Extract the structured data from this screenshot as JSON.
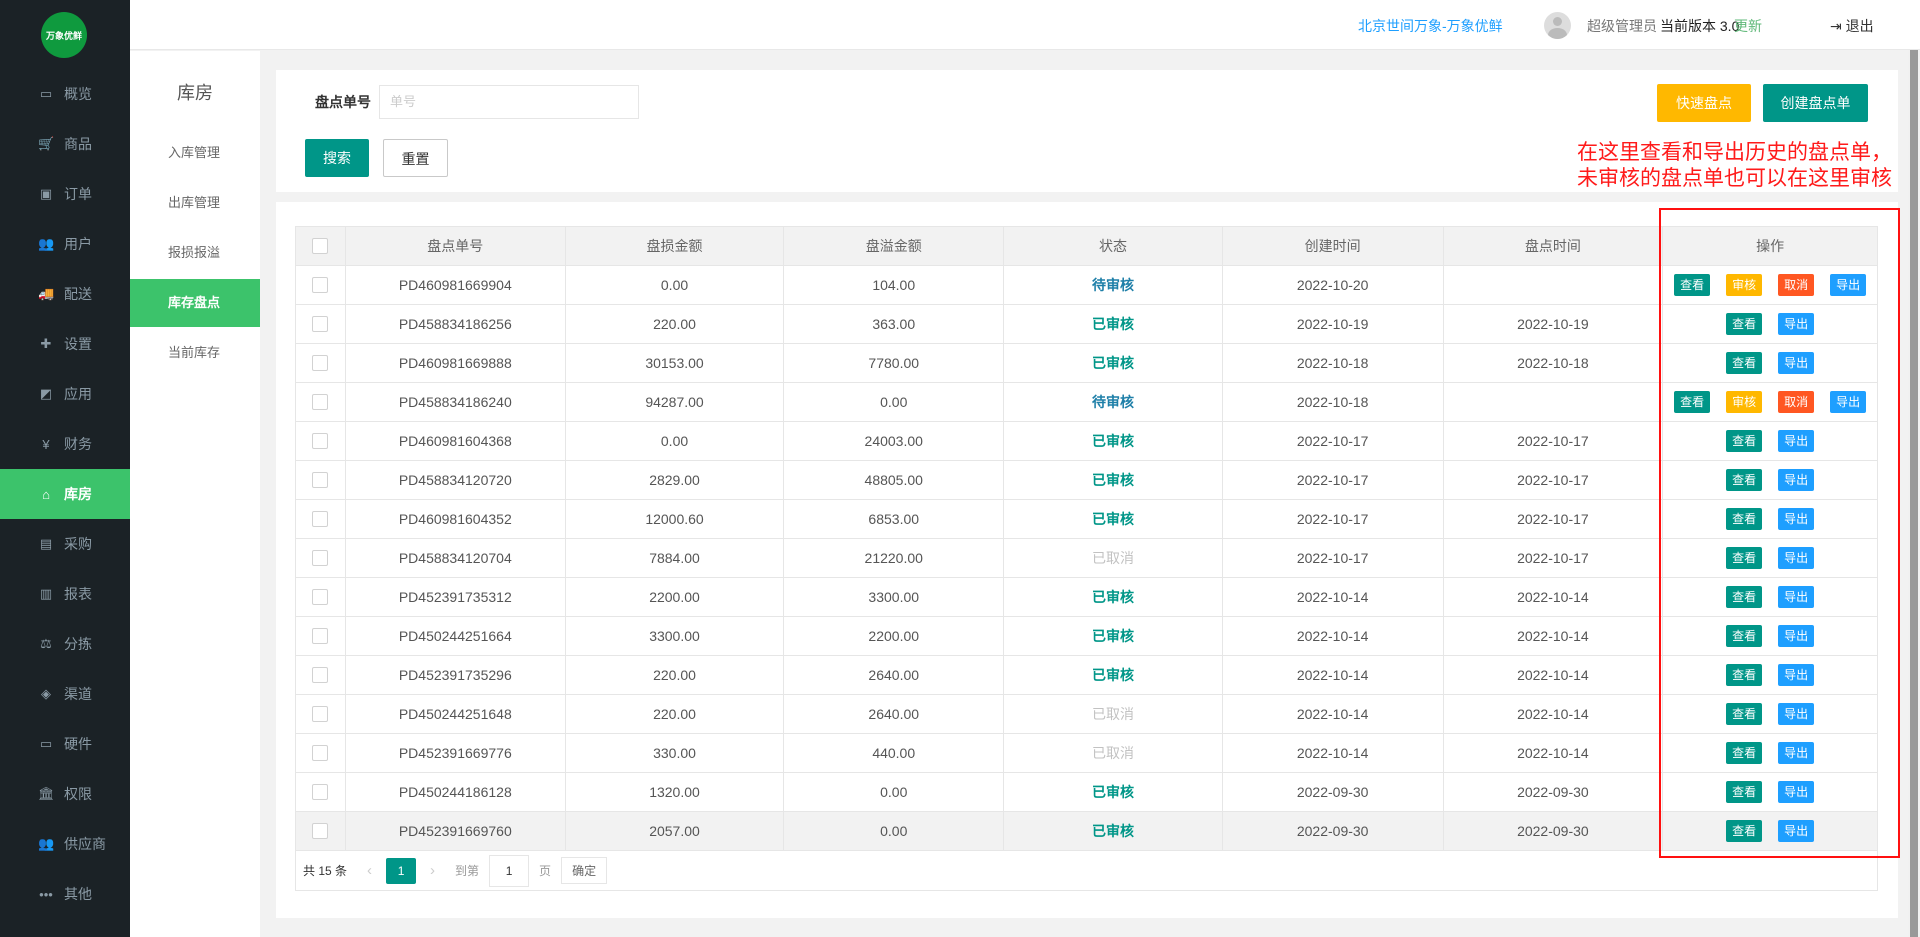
{
  "logo_text": "万象优鲜",
  "nav": [
    {
      "icon": "monitor-icon",
      "g": "▭",
      "label": "概览"
    },
    {
      "icon": "cart-icon",
      "g": "🛒",
      "label": "商品"
    },
    {
      "icon": "money-icon",
      "g": "▣",
      "label": "订单"
    },
    {
      "icon": "users-icon",
      "g": "👥",
      "label": "用户"
    },
    {
      "icon": "truck-icon",
      "g": "🚚",
      "label": "配送"
    },
    {
      "icon": "puzzle-icon",
      "g": "✚",
      "label": "设置"
    },
    {
      "icon": "app-icon",
      "g": "◩",
      "label": "应用"
    },
    {
      "icon": "yen-icon",
      "g": "¥",
      "label": "财务"
    },
    {
      "icon": "home-icon",
      "g": "⌂",
      "label": "库房",
      "active": true
    },
    {
      "icon": "bus-icon",
      "g": "▤",
      "label": "采购"
    },
    {
      "icon": "chart-icon",
      "g": "▥",
      "label": "报表"
    },
    {
      "icon": "scale-icon",
      "g": "⚖",
      "label": "分拣"
    },
    {
      "icon": "cube-icon",
      "g": "◈",
      "label": "渠道"
    },
    {
      "icon": "desktop-icon",
      "g": "▭",
      "label": "硬件"
    },
    {
      "icon": "bank-icon",
      "g": "🏛",
      "label": "权限"
    },
    {
      "icon": "group-icon",
      "g": "👥",
      "label": "供应商"
    },
    {
      "icon": "more-icon",
      "g": "•••",
      "label": "其他"
    }
  ],
  "header": {
    "company": "北京世间万象-万象优鲜",
    "user": "超级管理员",
    "version": "当前版本  3.0",
    "update": "更新",
    "logout": "退出"
  },
  "subnav": {
    "title": "库房",
    "items": [
      {
        "label": "入库管理"
      },
      {
        "label": "出库管理"
      },
      {
        "label": "报损报溢"
      },
      {
        "label": "库存盘点",
        "active": true
      },
      {
        "label": "当前库存"
      }
    ]
  },
  "search": {
    "label": "盘点单号",
    "placeholder": "单号",
    "search": "搜索",
    "reset": "重置",
    "quick": "快速盘点",
    "create": "创建盘点单"
  },
  "note": [
    "在这里查看和导出历史的盘点单，",
    "未审核的盘点单也可以在这里审核"
  ],
  "table": {
    "headers": [
      "盘点单号",
      "盘损金额",
      "盘溢金额",
      "状态",
      "创建时间",
      "盘点时间",
      "操作"
    ],
    "rows": [
      [
        "PD460981669904",
        "0.00",
        "104.00",
        "待审核",
        "2022-10-20",
        ""
      ],
      [
        "PD458834186256",
        "220.00",
        "363.00",
        "已审核",
        "2022-10-19",
        "2022-10-19"
      ],
      [
        "PD460981669888",
        "30153.00",
        "7780.00",
        "已审核",
        "2022-10-18",
        "2022-10-18"
      ],
      [
        "PD458834186240",
        "94287.00",
        "0.00",
        "待审核",
        "2022-10-18",
        ""
      ],
      [
        "PD460981604368",
        "0.00",
        "24003.00",
        "已审核",
        "2022-10-17",
        "2022-10-17"
      ],
      [
        "PD458834120720",
        "2829.00",
        "48805.00",
        "已审核",
        "2022-10-17",
        "2022-10-17"
      ],
      [
        "PD460981604352",
        "12000.60",
        "6853.00",
        "已审核",
        "2022-10-17",
        "2022-10-17"
      ],
      [
        "PD458834120704",
        "7884.00",
        "21220.00",
        "已取消",
        "2022-10-17",
        "2022-10-17"
      ],
      [
        "PD452391735312",
        "2200.00",
        "3300.00",
        "已审核",
        "2022-10-14",
        "2022-10-14"
      ],
      [
        "PD450244251664",
        "3300.00",
        "2200.00",
        "已审核",
        "2022-10-14",
        "2022-10-14"
      ],
      [
        "PD452391735296",
        "220.00",
        "2640.00",
        "已审核",
        "2022-10-14",
        "2022-10-14"
      ],
      [
        "PD450244251648",
        "220.00",
        "2640.00",
        "已取消",
        "2022-10-14",
        "2022-10-14"
      ],
      [
        "PD452391669776",
        "330.00",
        "440.00",
        "已取消",
        "2022-10-14",
        "2022-10-14"
      ],
      [
        "PD450244186128",
        "1320.00",
        "0.00",
        "已审核",
        "2022-09-30",
        "2022-09-30"
      ],
      [
        "PD452391669760",
        "2057.00",
        "0.00",
        "已审核",
        "2022-09-30",
        "2022-09-30"
      ]
    ],
    "actions": {
      "view": "查看",
      "audit": "审核",
      "cancel": "取消",
      "export": "导出"
    }
  },
  "pagination": {
    "total": "共 15 条",
    "current": "1",
    "goto": "到第",
    "page_value": "1",
    "page": "页",
    "confirm": "确定"
  },
  "colors": {
    "primary": "#009688",
    "audit": "#ffb800",
    "cancel": "#ff5722",
    "export": "#1e9fff",
    "active_nav": "#3cc36b"
  }
}
